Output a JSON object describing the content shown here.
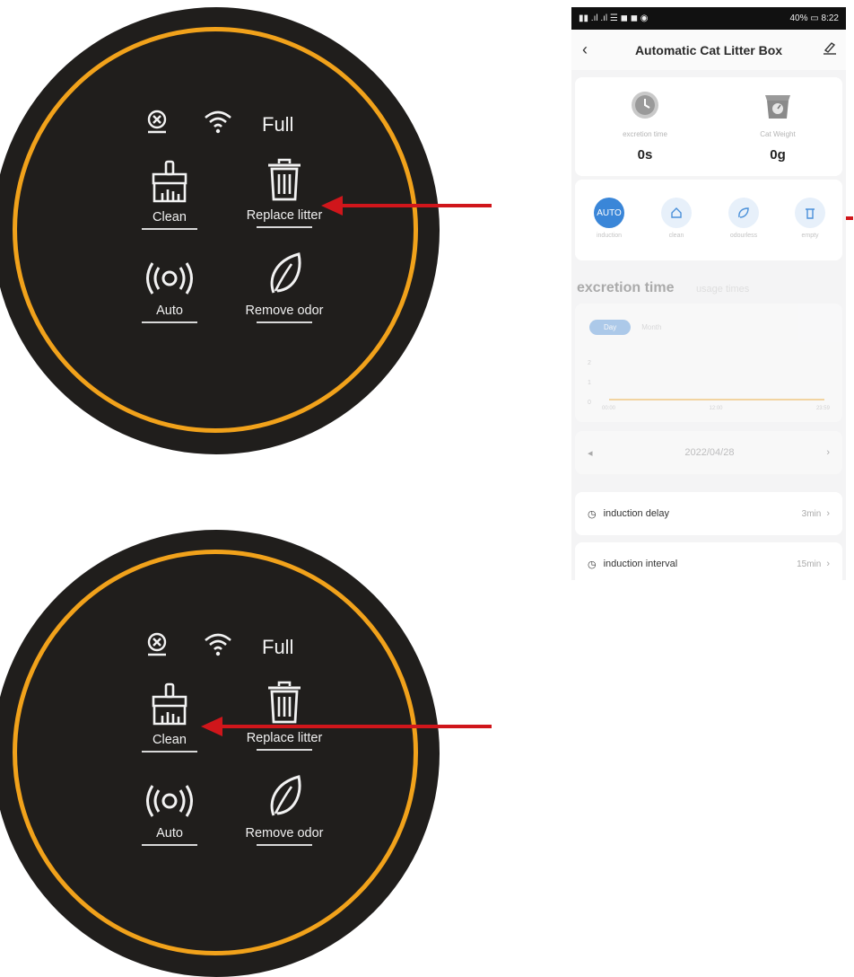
{
  "panels": [
    {
      "full_label": "Full",
      "buttons": {
        "clean": "Clean",
        "replace": "Replace litter",
        "auto": "Auto",
        "odor": "Remove odor"
      }
    },
    {
      "full_label": "Full",
      "buttons": {
        "clean": "Clean",
        "replace": "Replace litter",
        "auto": "Auto",
        "odor": "Remove odor"
      }
    }
  ],
  "phone": {
    "status_bar": {
      "battery": "40%",
      "time": "8:22"
    },
    "title": "Automatic Cat Litter Box",
    "stats": [
      {
        "caption": "excretion time",
        "value": "0s"
      },
      {
        "caption": "Cat Weight",
        "value": "0g"
      }
    ],
    "modes": [
      {
        "label": "induction",
        "text": "AUTO",
        "active": true
      },
      {
        "label": "clean"
      },
      {
        "label": "odourless"
      },
      {
        "label": "empty"
      }
    ],
    "tabs": {
      "excretion": "excretion time",
      "usage": "usage times"
    },
    "segment": {
      "day": "Day",
      "month": "Month"
    },
    "chart_y_ticks": [
      "2",
      "1",
      "0"
    ],
    "chart_x_ticks": [
      "00:00",
      "12:00",
      "23:59"
    ],
    "date_nav": {
      "date": "2022/04/28"
    },
    "settings": [
      {
        "label": "induction delay",
        "value": "3min"
      },
      {
        "label": "induction interval",
        "value": "15min"
      }
    ]
  },
  "colors": {
    "ring": "#f1a21b",
    "panel": "#201e1c",
    "arrow": "#d0161b",
    "accent": "#3a86d8"
  }
}
